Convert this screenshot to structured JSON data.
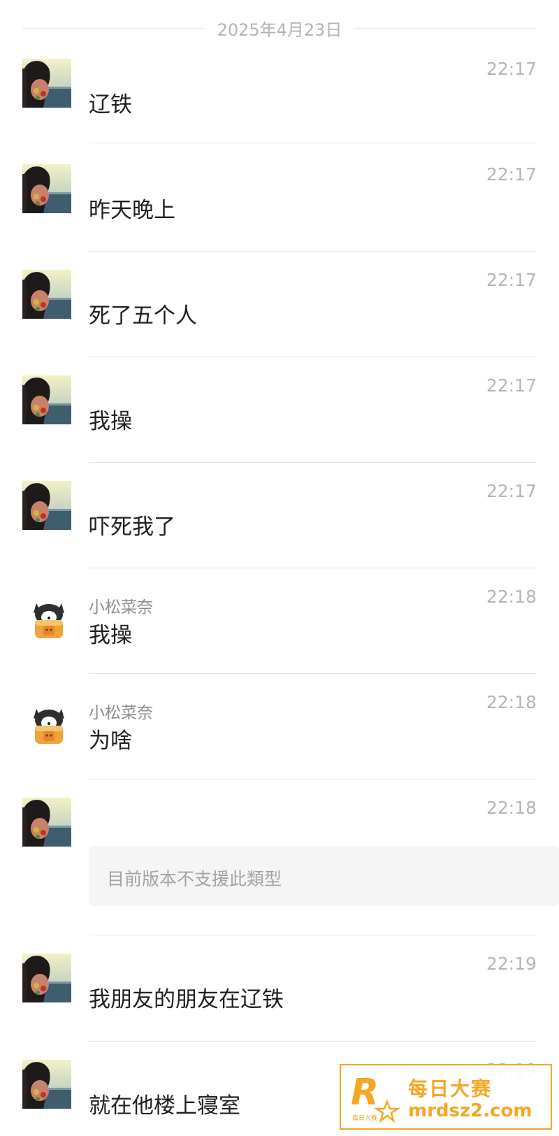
{
  "date_divider": "2025年4月23日",
  "messages": [
    {
      "time": "22:17",
      "text": "辽铁"
    },
    {
      "time": "22:17",
      "text": "昨天晚上"
    },
    {
      "time": "22:17",
      "text": "死了五个人"
    },
    {
      "time": "22:17",
      "text": "我操"
    },
    {
      "time": "22:17",
      "text": "吓死我了"
    },
    {
      "sender": "小松菜奈",
      "time": "22:18",
      "text": "我操"
    },
    {
      "sender": "小松菜奈",
      "time": "22:18",
      "text": "为啥"
    },
    {
      "time": "22:18",
      "text": "目前版本不支援此類型"
    },
    {
      "time": "22:19",
      "text": "我朋友的朋友在辽铁"
    },
    {
      "time": "22:19",
      "text": "就在他楼上寝室"
    }
  ],
  "watermark": {
    "name": "每日大赛",
    "url": "mrdsz2.com",
    "logo_letter": "R",
    "logo_small": "每日大赛"
  },
  "colors": {
    "watermark": "#f5a623",
    "text": "#1f1f1f",
    "time": "#b5b5b5",
    "sender": "#8c8c8c"
  }
}
